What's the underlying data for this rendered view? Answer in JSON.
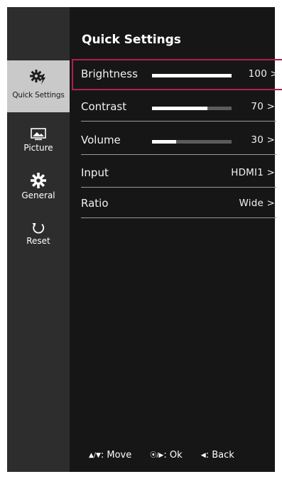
{
  "sidebar": {
    "items": [
      {
        "label": "Quick Settings",
        "icon": "quick-settings-icon",
        "active": true
      },
      {
        "label": "Picture",
        "icon": "picture-icon",
        "active": false
      },
      {
        "label": "General",
        "icon": "gear-icon",
        "active": false
      },
      {
        "label": "Reset",
        "icon": "reset-icon",
        "active": false
      }
    ]
  },
  "main": {
    "title": "Quick Settings",
    "rows": [
      {
        "label": "Brightness",
        "value": "100 >",
        "level": 100
      },
      {
        "label": "Contrast",
        "value": "70 >",
        "level": 70
      },
      {
        "label": "Volume",
        "value": "30 >",
        "level": 30
      },
      {
        "label": "Input",
        "value": "HDMI1 >"
      },
      {
        "label": "Ratio",
        "value": "Wide >"
      }
    ]
  },
  "footer": {
    "move_symbol": "▲/▼",
    "move_label": ": Move",
    "ok_symbol": "⦿/▶",
    "ok_label": ": Ok",
    "back_symbol": "◀",
    "back_label": ": Back"
  },
  "colors": {
    "screen_bg": "#161616",
    "sidebar_bg": "#2d2d2d",
    "active_item_bg": "#c9c9c9",
    "selection_outline": "#b0204a"
  }
}
